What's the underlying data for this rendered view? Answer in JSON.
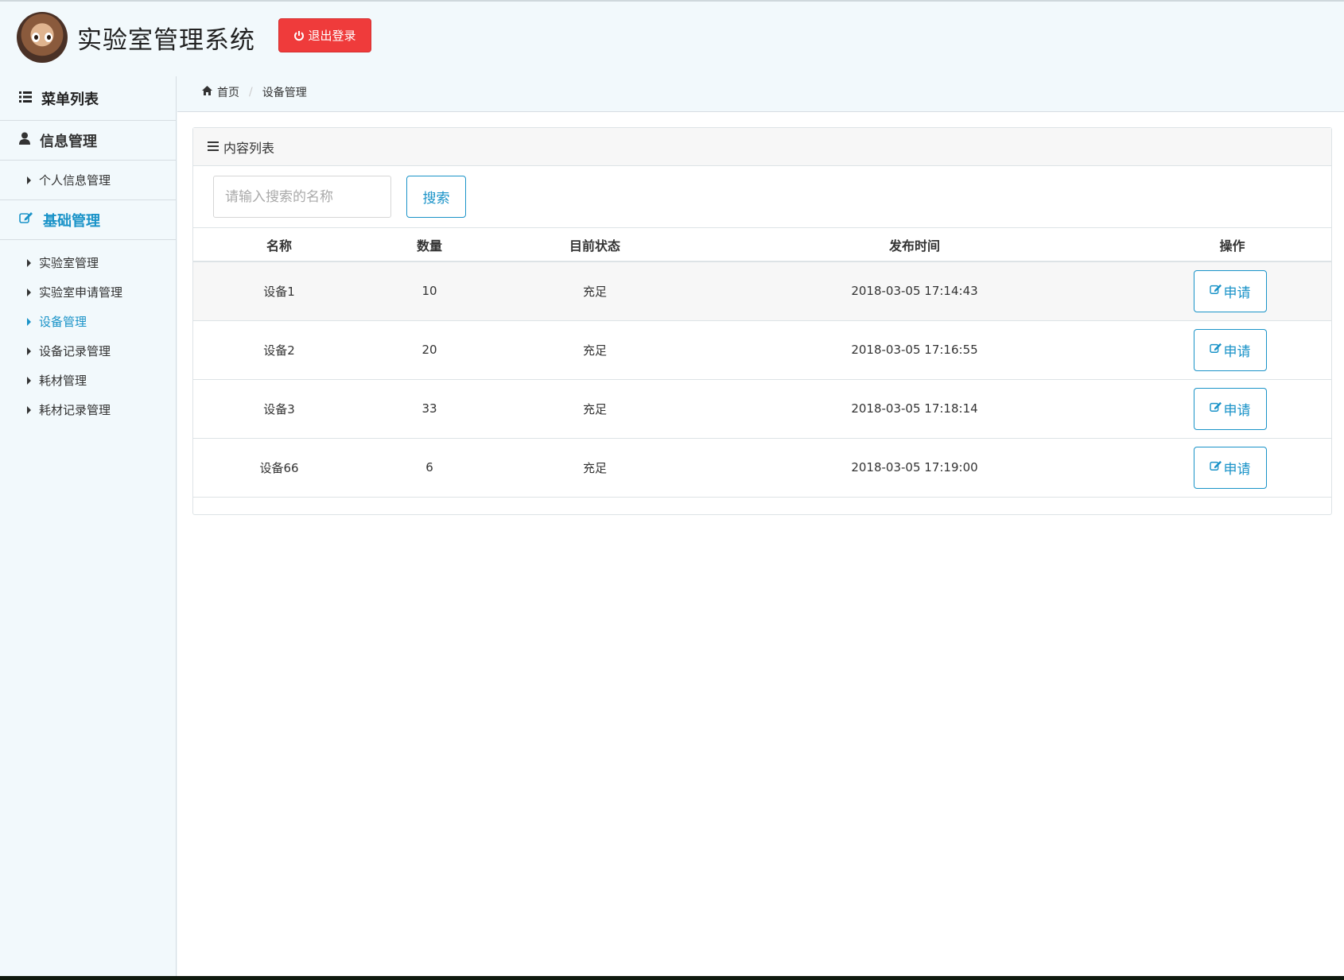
{
  "header": {
    "title": "实验室管理系统",
    "logout_label": "退出登录"
  },
  "sidebar": {
    "menu_title": "菜单列表",
    "groups": [
      {
        "label": "信息管理",
        "items": [
          {
            "label": "个人信息管理"
          }
        ]
      },
      {
        "label": "基础管理",
        "items": [
          {
            "label": "实验室管理"
          },
          {
            "label": "实验室申请管理"
          },
          {
            "label": "设备管理"
          },
          {
            "label": "设备记录管理"
          },
          {
            "label": "耗材管理"
          },
          {
            "label": "耗材记录管理"
          }
        ]
      }
    ],
    "active_item": "设备管理"
  },
  "breadcrumb": {
    "home": "首页",
    "current": "设备管理"
  },
  "panel": {
    "title": "内容列表",
    "search_placeholder": "请输入搜索的名称",
    "search_label": "搜索"
  },
  "table": {
    "headers": [
      "名称",
      "数量",
      "目前状态",
      "发布时间",
      "操作"
    ],
    "rows": [
      {
        "name": "设备1",
        "qty": "10",
        "status": "充足",
        "time": "2018-03-05 17:14:43",
        "action": "申请"
      },
      {
        "name": "设备2",
        "qty": "20",
        "status": "充足",
        "time": "2018-03-05 17:16:55",
        "action": "申请"
      },
      {
        "name": "设备3",
        "qty": "33",
        "status": "充足",
        "time": "2018-03-05 17:18:14",
        "action": "申请"
      },
      {
        "name": "设备66",
        "qty": "6",
        "status": "充足",
        "time": "2018-03-05 17:19:00",
        "action": "申请"
      }
    ]
  },
  "colors": {
    "accent": "#1a93c8",
    "danger": "#ef3b3b",
    "bg": "#f2f9fc"
  }
}
